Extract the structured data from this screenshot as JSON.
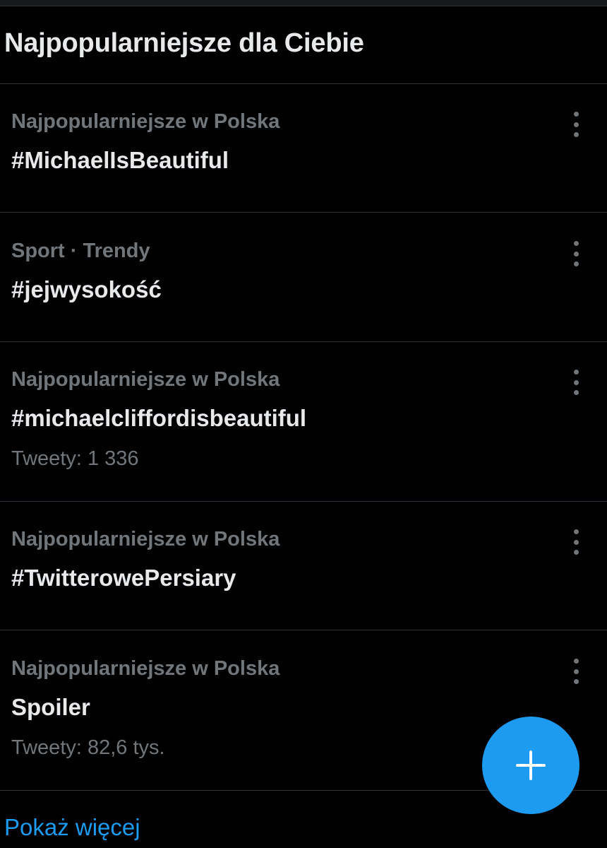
{
  "section": {
    "title": "Najpopularniejsze dla Ciebie"
  },
  "trends": [
    {
      "meta": "Najpopularniejsze w Polska",
      "name": "#MichaelIsBeautiful",
      "count": ""
    },
    {
      "meta": "Sport · Trendy",
      "name": "#jejwysokość",
      "count": ""
    },
    {
      "meta": "Najpopularniejsze w Polska",
      "name": "#michaelcliffordisbeautiful",
      "count": "Tweety: 1 336"
    },
    {
      "meta": "Najpopularniejsze w Polska",
      "name": "#TwitterowePersiary",
      "count": ""
    },
    {
      "meta": "Najpopularniejsze w Polska",
      "name": "Spoiler",
      "count": "Tweety: 82,6 tys."
    }
  ],
  "footer": {
    "show_more": "Pokaż więcej"
  },
  "icons": {
    "more": "more-vertical-icon",
    "compose": "plus-icon"
  },
  "colors": {
    "background": "#000000",
    "accent": "#1d9bf0",
    "text_primary": "#e7e9ea",
    "text_secondary": "#71767b",
    "divider": "#2f3336"
  }
}
